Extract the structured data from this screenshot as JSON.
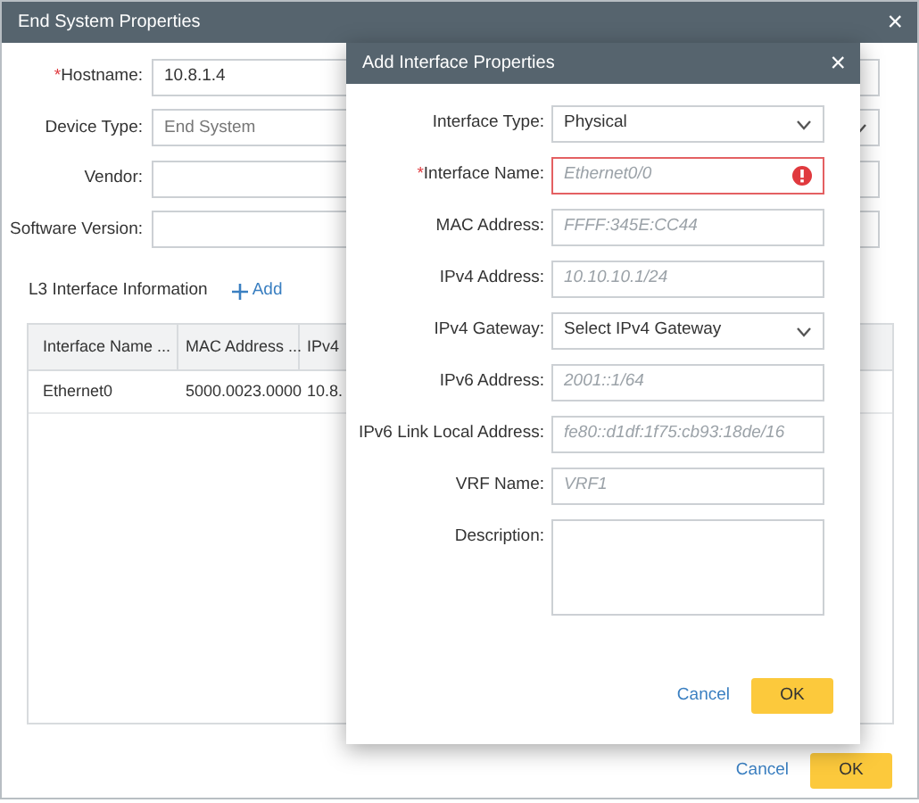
{
  "window": {
    "title": "End System Properties",
    "close": "×"
  },
  "fields": [
    {
      "label": "Hostname:",
      "required_mark": "*",
      "kind": "input",
      "value": "10.8.1.4"
    },
    {
      "label": "Device Type:",
      "kind": "select",
      "value": "End System",
      "disabled": true
    },
    {
      "label": "Vendor:",
      "kind": "input"
    },
    {
      "label": "Software Version:",
      "kind": "input"
    }
  ],
  "l3": {
    "label": "L3 Interface Information",
    "add_button": "Add"
  },
  "table": {
    "columns": [
      "Interface Name ...",
      "MAC Address ...",
      "IPv4"
    ],
    "rows": [
      [
        "Ethernet0",
        "5000.0023.0000",
        "10.8."
      ]
    ]
  },
  "buttons": {
    "cancel": "Cancel",
    "ok": "OK"
  },
  "dialog": {
    "title": "Add Interface Properties",
    "close": "×",
    "fields": [
      {
        "label": "Interface Type:",
        "kind": "select",
        "value": "Physical"
      },
      {
        "label": "Interface Name:",
        "required_mark": "*",
        "kind": "input",
        "placeholder": "Ethernet0/0",
        "error": true
      },
      {
        "label": "MAC Address:",
        "kind": "input",
        "placeholder": "FFFF:345E:CC44"
      },
      {
        "label": "IPv4 Address:",
        "kind": "input",
        "placeholder": "10.10.10.1/24"
      },
      {
        "label": "IPv4 Gateway:",
        "kind": "select",
        "value": "Select IPv4 Gateway"
      },
      {
        "label": "IPv6 Address:",
        "kind": "input",
        "placeholder": "2001::1/64"
      },
      {
        "label": "IPv6 Link Local Address:",
        "kind": "input",
        "placeholder": "fe80::d1df:1f75:cb93:18de/16"
      },
      {
        "label": "VRF Name:",
        "kind": "input",
        "placeholder": "VRF1"
      },
      {
        "label": "Description:",
        "kind": "textarea"
      }
    ],
    "buttons": {
      "cancel": "Cancel",
      "ok": "OK"
    }
  }
}
